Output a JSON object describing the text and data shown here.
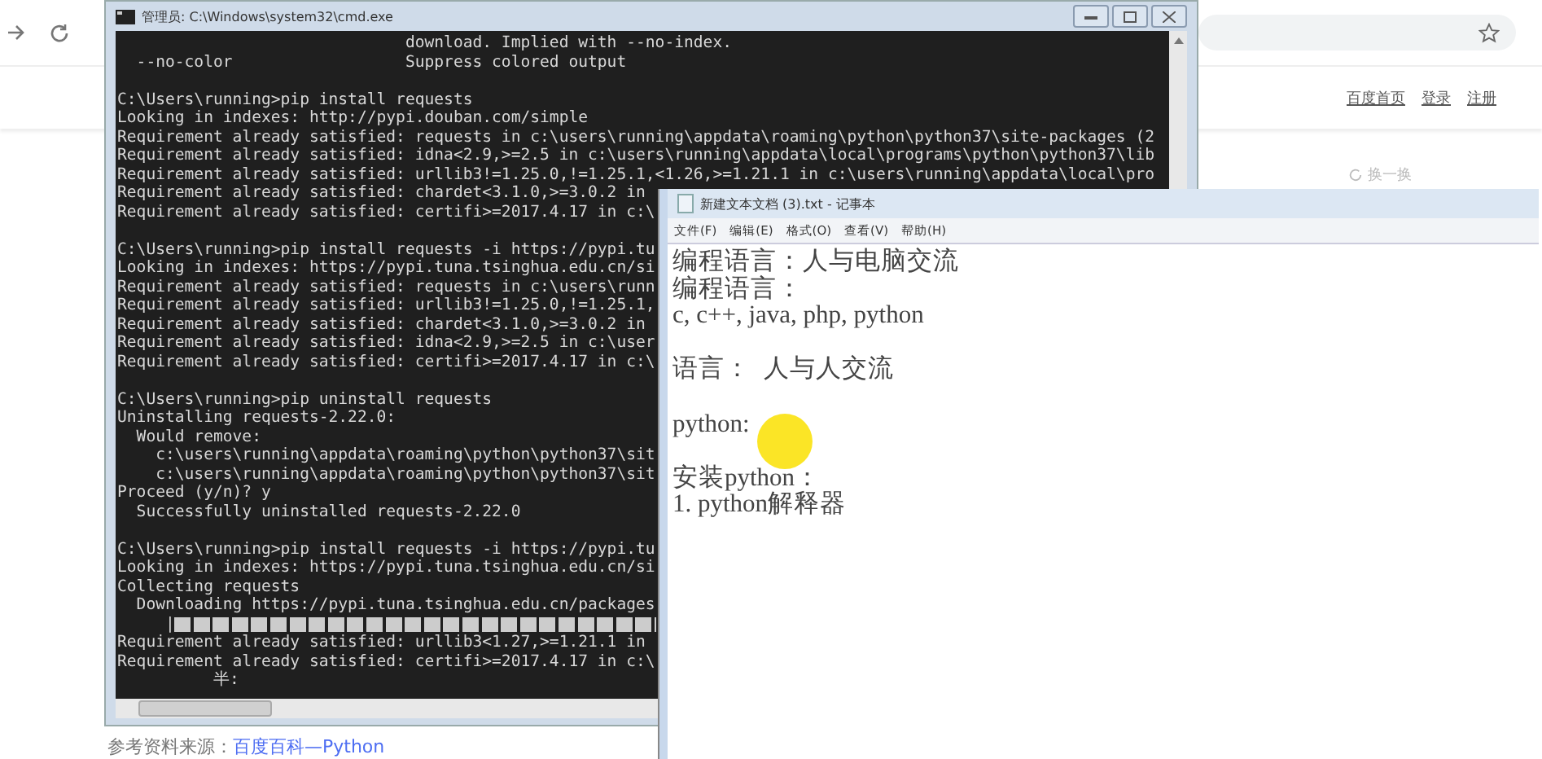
{
  "browser": {
    "links": [
      "百度首页",
      "登录",
      "注册"
    ],
    "refresh_link": "换一换",
    "footer": {
      "label": "参考资料来源：",
      "link": "百度百科—Python"
    }
  },
  "cmd": {
    "title": "管理员: C:\\Windows\\system32\\cmd.exe",
    "blocks": [
      [
        {
          "kind": "text",
          "text": "                              download. Implied with --no-index."
        },
        {
          "kind": "text",
          "text": "  --no-color                  Suppress colored output"
        }
      ],
      [
        {
          "kind": "text",
          "text": "C:\\Users\\running>pip install requests"
        },
        {
          "kind": "text",
          "text": "Looking in indexes: http://pypi.douban.com/simple"
        },
        {
          "kind": "text",
          "text": "Requirement already satisfied: requests in c:\\users\\running\\appdata\\roaming\\python\\python37\\site-packages (2"
        },
        {
          "kind": "text",
          "text": "Requirement already satisfied: idna<2.9,>=2.5 in c:\\users\\running\\appdata\\local\\programs\\python\\python37\\lib"
        },
        {
          "kind": "text",
          "text": "Requirement already satisfied: urllib3!=1.25.0,!=1.25.1,<1.26,>=1.21.1 in c:\\users\\running\\appdata\\local\\pro"
        },
        {
          "kind": "text",
          "text": "Requirement already satisfied: chardet<3.1.0,>=3.0.2 in"
        },
        {
          "kind": "text",
          "text": "Requirement already satisfied: certifi>=2017.4.17 in c:\\"
        }
      ],
      [
        {
          "kind": "text",
          "text": "C:\\Users\\running>pip install requests -i https://pypi.tu"
        },
        {
          "kind": "text",
          "text": "Looking in indexes: https://pypi.tuna.tsinghua.edu.cn/si"
        },
        {
          "kind": "text",
          "text": "Requirement already satisfied: requests in c:\\users\\runn"
        },
        {
          "kind": "text",
          "text": "Requirement already satisfied: urllib3!=1.25.0,!=1.25.1,"
        },
        {
          "kind": "text",
          "text": "Requirement already satisfied: chardet<3.1.0,>=3.0.2 in"
        },
        {
          "kind": "text",
          "text": "Requirement already satisfied: idna<2.9,>=2.5 in c:\\user"
        },
        {
          "kind": "text",
          "text": "Requirement already satisfied: certifi>=2017.4.17 in c:\\"
        }
      ],
      [
        {
          "kind": "text",
          "text": "C:\\Users\\running>pip uninstall requests"
        },
        {
          "kind": "text",
          "text": "Uninstalling requests-2.22.0:"
        },
        {
          "kind": "text",
          "text": "  Would remove:"
        },
        {
          "kind": "text",
          "text": "    c:\\users\\running\\appdata\\roaming\\python\\python37\\sit"
        },
        {
          "kind": "text",
          "text": "    c:\\users\\running\\appdata\\roaming\\python\\python37\\sit"
        },
        {
          "kind": "text",
          "text": "Proceed (y/n)? y"
        },
        {
          "kind": "text",
          "text": "  Successfully uninstalled requests-2.22.0"
        }
      ],
      [
        {
          "kind": "text",
          "text": "C:\\Users\\running>pip install requests -i https://pypi.tu"
        },
        {
          "kind": "text",
          "text": "Looking in indexes: https://pypi.tuna.tsinghua.edu.cn/si"
        },
        {
          "kind": "text",
          "text": "Collecting requests"
        },
        {
          "kind": "text",
          "text": "  Downloading https://pypi.tuna.tsinghua.edu.cn/packages"
        },
        {
          "kind": "progress",
          "prefix": "     |"
        },
        {
          "kind": "text",
          "text": "Requirement already satisfied: urllib3<1.27,>=1.21.1 in"
        },
        {
          "kind": "text",
          "text": "Requirement already satisfied: certifi>=2017.4.17 in c:\\"
        },
        {
          "kind": "text",
          "text": "          半:"
        }
      ]
    ]
  },
  "notepad": {
    "title": "新建文本文档 (3).txt - 记事本",
    "menu": [
      "文件(F)",
      "编辑(E)",
      "格式(O)",
      "查看(V)",
      "帮助(H)"
    ],
    "blocks": [
      [
        "编程语言：人与电脑交流",
        "编程语言：",
        "c, c++, java, php, python"
      ],
      [
        "语言：  人与人交流"
      ],
      [
        "python:"
      ],
      [
        "安装python：",
        "1. python解释器"
      ]
    ]
  }
}
